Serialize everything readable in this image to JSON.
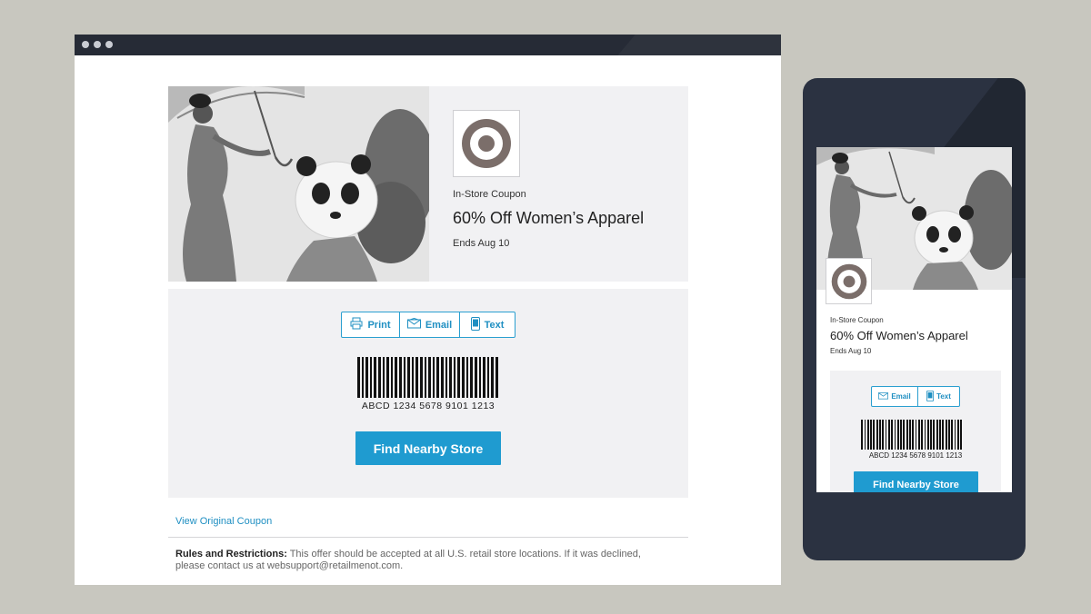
{
  "browser": {
    "dots": 3
  },
  "coupon": {
    "kicker": "In-Store Coupon",
    "title": "60% Off Women’s Apparel",
    "ends": "Ends Aug 10",
    "barcode_text": "ABCD 1234 5678 9101 1213",
    "cta_label": "Find Nearby Store"
  },
  "share_desktop": {
    "print": "Print",
    "email": "Email",
    "text": "Text"
  },
  "share_mobile": {
    "email": "Email",
    "text": "Text"
  },
  "footer": {
    "view_original": "View Original Coupon",
    "rules_label": "Rules and Restrictions:",
    "rules_text": " This offer should be accepted at all U.S. retail store locations. If it was declined, please contact us at websupport@retailmenot.com."
  },
  "colors": {
    "accent": "#1f9bd0",
    "logo": "#7b6e6a",
    "background": "#c8c7bf",
    "device_frame": "#2b3241"
  },
  "icons": [
    "printer-icon",
    "envelope-icon",
    "phone-icon",
    "bullseye-logo"
  ]
}
